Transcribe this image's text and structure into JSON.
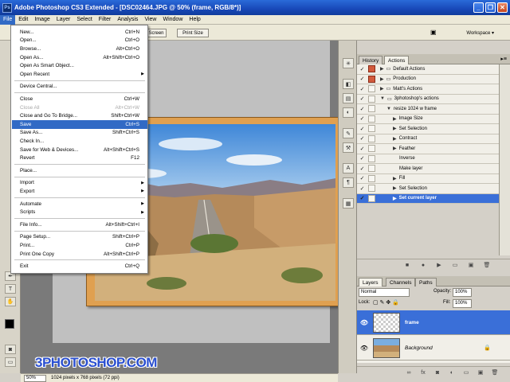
{
  "app": {
    "title": "Adobe Photoshop CS3 Extended - [DSC02464.JPG @ 50% (frame, RGB/8*)]",
    "logo": "Ps"
  },
  "window_controls": [
    "_",
    "❐",
    "✕"
  ],
  "menubar": [
    "File",
    "Edit",
    "Image",
    "Layer",
    "Select",
    "Filter",
    "Analysis",
    "View",
    "Window",
    "Help"
  ],
  "options_bar": {
    "screen_btn": "Screen",
    "print_size_btn": "Print Size",
    "workspace": "Workspace ▾"
  },
  "file_menu": [
    {
      "label": "New...",
      "shortcut": "Ctrl+N"
    },
    {
      "label": "Open...",
      "shortcut": "Ctrl+O"
    },
    {
      "label": "Browse...",
      "shortcut": "Alt+Ctrl+O"
    },
    {
      "label": "Open As...",
      "shortcut": "Alt+Shift+Ctrl+O"
    },
    {
      "label": "Open As Smart Object...",
      "shortcut": ""
    },
    {
      "label": "Open Recent",
      "shortcut": "",
      "submenu": true
    },
    {
      "sep": true
    },
    {
      "label": "Device Central...",
      "shortcut": ""
    },
    {
      "sep": true
    },
    {
      "label": "Close",
      "shortcut": "Ctrl+W"
    },
    {
      "label": "Close All",
      "shortcut": "Alt+Ctrl+W",
      "disabled": true
    },
    {
      "label": "Close and Go To Bridge...",
      "shortcut": "Shift+Ctrl+W"
    },
    {
      "label": "Save",
      "shortcut": "Ctrl+S",
      "highlighted": true
    },
    {
      "label": "Save As...",
      "shortcut": "Shift+Ctrl+S"
    },
    {
      "label": "Check In...",
      "shortcut": ""
    },
    {
      "label": "Save for Web & Devices...",
      "shortcut": "Alt+Shift+Ctrl+S"
    },
    {
      "label": "Revert",
      "shortcut": "F12"
    },
    {
      "sep": true
    },
    {
      "label": "Place...",
      "shortcut": ""
    },
    {
      "sep": true
    },
    {
      "label": "Import",
      "shortcut": "",
      "submenu": true
    },
    {
      "label": "Export",
      "shortcut": "",
      "submenu": true
    },
    {
      "sep": true
    },
    {
      "label": "Automate",
      "shortcut": "",
      "submenu": true
    },
    {
      "label": "Scripts",
      "shortcut": "",
      "submenu": true
    },
    {
      "sep": true
    },
    {
      "label": "File Info...",
      "shortcut": "Alt+Shift+Ctrl+I"
    },
    {
      "sep": true
    },
    {
      "label": "Page Setup...",
      "shortcut": "Shift+Ctrl+P"
    },
    {
      "label": "Print...",
      "shortcut": "Ctrl+P"
    },
    {
      "label": "Print One Copy",
      "shortcut": "Alt+Shift+Ctrl+P"
    },
    {
      "sep": true
    },
    {
      "label": "Exit",
      "shortcut": "Ctrl+Q"
    }
  ],
  "actions_panel": {
    "tabs": [
      "History",
      "Actions"
    ],
    "rows": [
      {
        "label": "Default Actions",
        "type": "set"
      },
      {
        "label": "Production",
        "type": "set"
      },
      {
        "label": "Matt's Actions",
        "type": "set"
      },
      {
        "label": "3photoshop's actions",
        "type": "set-open"
      },
      {
        "label": "resize 1024 w frame",
        "type": "action-open"
      },
      {
        "label": "Image Size",
        "type": "step"
      },
      {
        "label": "Set Selection",
        "type": "step"
      },
      {
        "label": "Contract",
        "type": "step"
      },
      {
        "label": "Feather",
        "type": "step"
      },
      {
        "label": "Inverse",
        "type": "step-plain"
      },
      {
        "label": "Make layer",
        "type": "step-plain"
      },
      {
        "label": "Fill",
        "type": "step"
      },
      {
        "label": "Set Selection",
        "type": "step"
      },
      {
        "label": "Set current layer",
        "type": "step",
        "selected": true
      }
    ]
  },
  "layers_panel": {
    "tabs": [
      "Layers",
      "Channels",
      "Paths"
    ],
    "blend_mode": "Normal",
    "opacity_label": "Opacity:",
    "opacity": "100%",
    "lock_label": "Lock:",
    "fill_label": "Fill:",
    "fill": "100%",
    "layers": [
      {
        "name": "frame",
        "selected": true
      },
      {
        "name": "Background",
        "locked": true
      }
    ]
  },
  "status": {
    "zoom": "50%",
    "info": "1024 pixels x 768 pixels (72 ppi)"
  },
  "watermark": "3PHOTOSHOP.COM"
}
